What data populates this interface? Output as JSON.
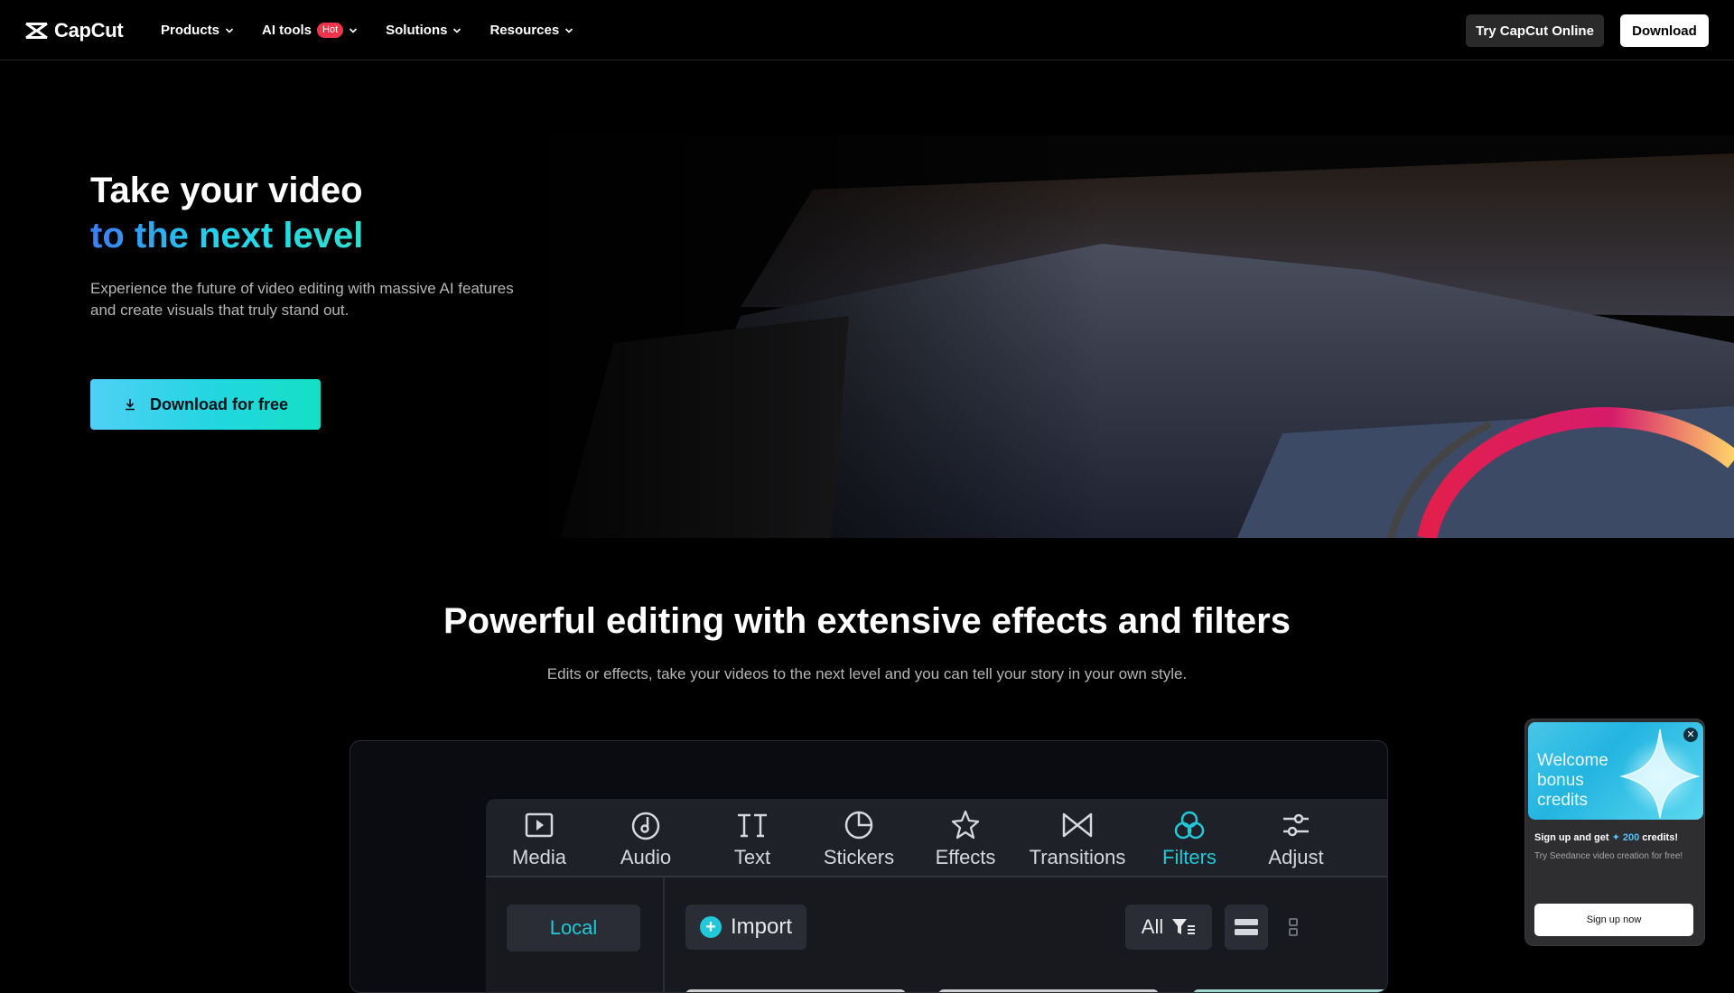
{
  "nav": {
    "logo_text": "CapCut",
    "items": [
      {
        "label": "Products",
        "has_badge": false
      },
      {
        "label": "AI tools",
        "badge": "Hot"
      },
      {
        "label": "Solutions"
      },
      {
        "label": "Resources"
      }
    ],
    "try_online_label": "Try CapCut Online",
    "download_label": "Download"
  },
  "hero": {
    "title_line1": "Take your video",
    "title_line2": "to the next level",
    "subtitle": "Experience the future of video editing with massive AI features and create visuals that truly stand out.",
    "cta_label": "Download for free"
  },
  "features": {
    "title": "Powerful editing with extensive effects and filters",
    "subtitle": "Edits or effects, take your videos to the next level and you can tell your story in your own style."
  },
  "editor": {
    "tools": [
      {
        "label": "Media",
        "icon": "media-icon"
      },
      {
        "label": "Audio",
        "icon": "audio-icon"
      },
      {
        "label": "Text",
        "icon": "text-icon"
      },
      {
        "label": "Stickers",
        "icon": "stickers-icon"
      },
      {
        "label": "Effects",
        "icon": "effects-icon"
      },
      {
        "label": "Transitions",
        "icon": "transitions-icon"
      },
      {
        "label": "Filters",
        "icon": "filters-icon",
        "active": true
      },
      {
        "label": "Adjust",
        "icon": "adjust-icon"
      }
    ],
    "local_tab": "Local",
    "import_label": "Import",
    "filter_all_label": "All"
  },
  "popup": {
    "banner_text": "Welcome bonus credits",
    "line1_prefix": "Sign up and get",
    "credits_value": "200",
    "line1_suffix": "credits!",
    "line2": "Try Seedance video creation for free!",
    "button_label": "Sign up now"
  },
  "colors": {
    "accent_teal": "#22c7d8",
    "hot_badge": "#f0344c",
    "cta_gradient_start": "#4fd0f5",
    "cta_gradient_end": "#14e0c4"
  }
}
